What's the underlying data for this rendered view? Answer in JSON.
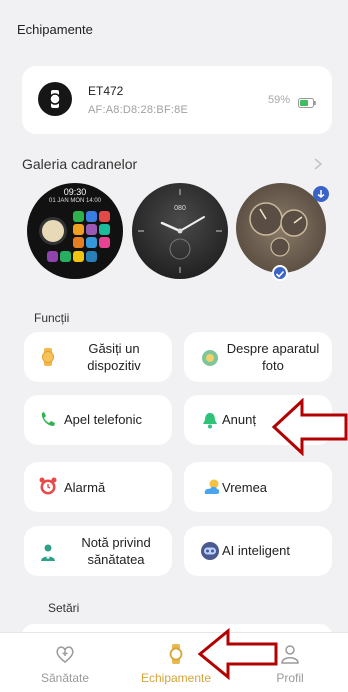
{
  "header": {
    "title": "Echipamente"
  },
  "device": {
    "name": "ET472",
    "mac": "AF:A8:D8:28:BF:8E",
    "battery": "59%",
    "battery_level": 0.59
  },
  "gallery": {
    "title": "Galeria cadranelor",
    "face1": {
      "time": "09:30",
      "date": "01 JAN MON 14:00"
    },
    "face2": {
      "label": "080"
    }
  },
  "functions": {
    "title": "Funcții",
    "items": [
      {
        "label_line1": "Găsiți un",
        "label_line2": "dispozitiv"
      },
      {
        "label_line1": "Despre aparatul",
        "label_line2": "foto"
      },
      {
        "label_line1": "Apel telefonic",
        "label_line2": ""
      },
      {
        "label_line1": "Anunț",
        "label_line2": ""
      },
      {
        "label_line1": "Alarmă",
        "label_line2": ""
      },
      {
        "label_line1": "Vremea",
        "label_line2": ""
      },
      {
        "label_line1": "Notă privind",
        "label_line2": "sănătatea"
      },
      {
        "label_line1": "AI inteligent",
        "label_line2": ""
      }
    ]
  },
  "settings": {
    "title": "Setări"
  },
  "nav": {
    "items": [
      {
        "label": "Sănătate"
      },
      {
        "label": "Echipamente"
      },
      {
        "label": "Profil"
      }
    ],
    "active_color": "#d5a43a",
    "inactive_color": "#9a9a9a"
  }
}
